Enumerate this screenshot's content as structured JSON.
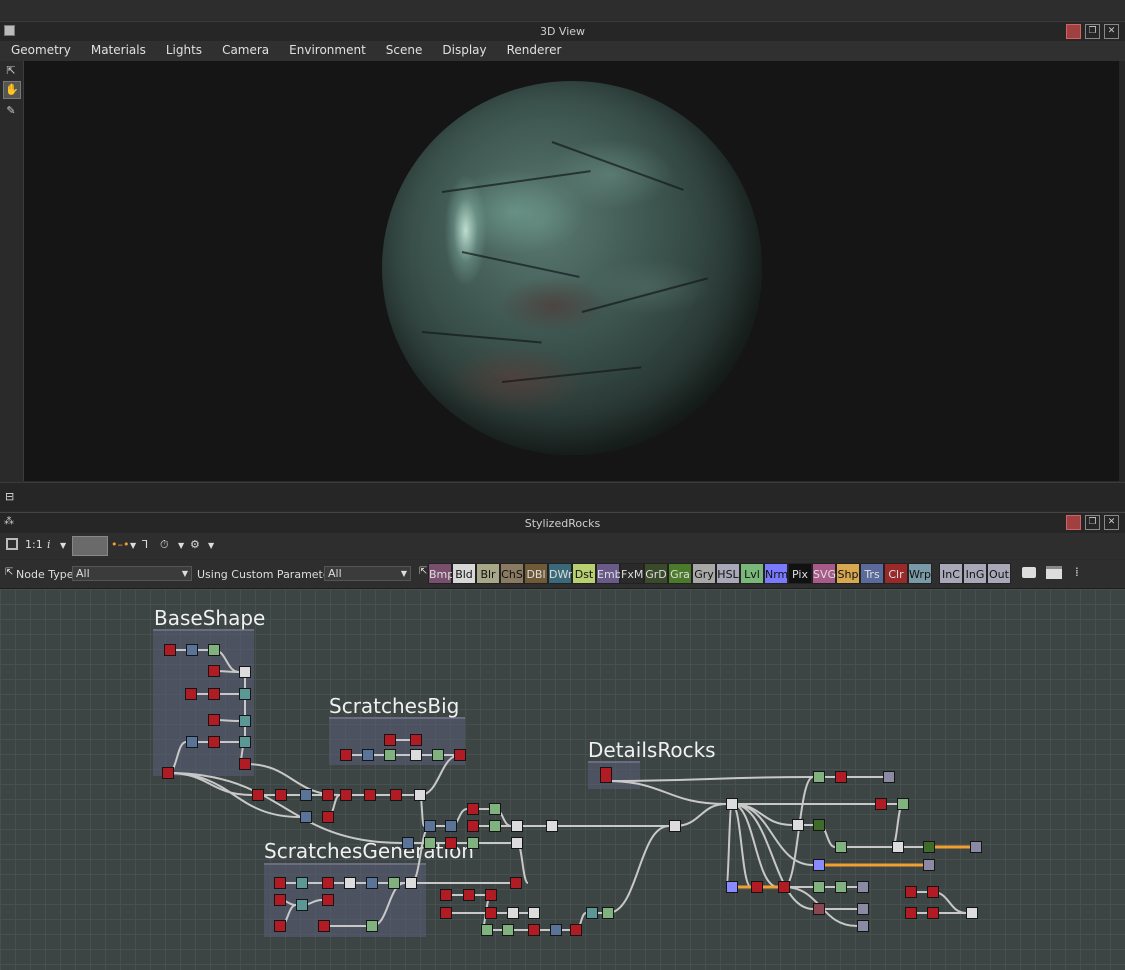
{
  "view3d": {
    "title": "3D View",
    "menu": [
      "Geometry",
      "Materials",
      "Lights",
      "Camera",
      "Environment",
      "Scene",
      "Display",
      "Renderer"
    ]
  },
  "graph_panel": {
    "title": "StylizedRocks",
    "zoom_label": "1:1",
    "info_label": "i",
    "node_type_label": "Node Type",
    "node_type_value": "All",
    "params_label": "Using Custom Parameters",
    "params_value": "All",
    "categories": [
      {
        "label": "Bmp",
        "color": "#7a4f6e"
      },
      {
        "label": "Bld",
        "color": "#d8d8d8"
      },
      {
        "label": "Blr",
        "color": "#a8a888"
      },
      {
        "label": "ChS",
        "color": "#8a7a62"
      },
      {
        "label": "DBl",
        "color": "#6e5a36"
      },
      {
        "label": "DWr",
        "color": "#3a6a7a"
      },
      {
        "label": "Dst",
        "color": "#b8d070"
      },
      {
        "label": "Emb",
        "color": "#6a5a8a"
      },
      {
        "label": "FxM",
        "color": "#2a2a2a"
      },
      {
        "label": "GrD",
        "color": "#3a4a2a"
      },
      {
        "label": "Gra",
        "color": "#4a7a2a"
      },
      {
        "label": "Gry",
        "color": "#a8a8a8"
      },
      {
        "label": "HSL",
        "color": "#a8a8b8"
      },
      {
        "label": "Lvl",
        "color": "#7ab87a"
      },
      {
        "label": "Nrm",
        "color": "#7a7aff"
      },
      {
        "label": "Pix",
        "color": "#111111"
      },
      {
        "label": "SVG",
        "color": "#a85a88"
      },
      {
        "label": "Shp",
        "color": "#d8a850"
      },
      {
        "label": "Trs",
        "color": "#5a6a9a"
      },
      {
        "label": "Clr",
        "color": "#9a2a2a"
      },
      {
        "label": "Wrp",
        "color": "#7a9aa8"
      },
      {
        "label": "InC",
        "color": "#a8a8b8"
      },
      {
        "label": "InG",
        "color": "#a8a8b8"
      },
      {
        "label": "Out",
        "color": "#a8a8b8"
      }
    ],
    "frames": [
      "BaseShape",
      "ScratchesBig",
      "DetailsRocks",
      "ScratchesGeneration"
    ]
  }
}
